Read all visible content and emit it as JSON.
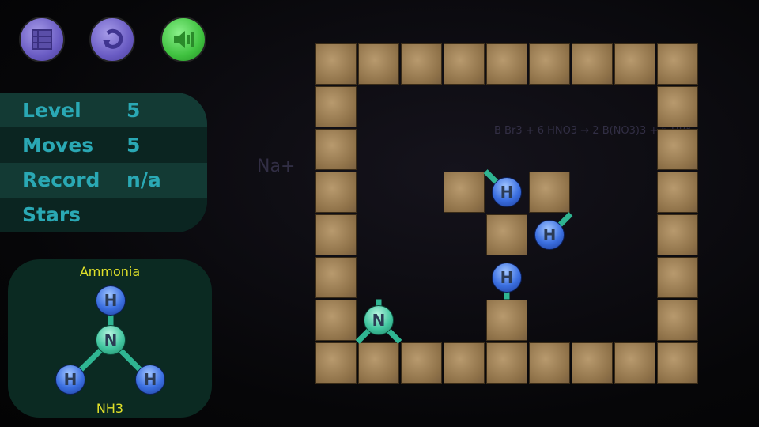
{
  "toolbar": {
    "buttons": [
      {
        "name": "menu",
        "icon": "level-menu-icon",
        "color": "#6a5cc4"
      },
      {
        "name": "restart",
        "icon": "restart-icon",
        "color": "#6a5cc4"
      },
      {
        "name": "sound",
        "icon": "speaker-icon",
        "color": "#3fc13f"
      }
    ]
  },
  "stats": {
    "level_label": "Level",
    "level_value": "5",
    "moves_label": "Moves",
    "moves_value": "5",
    "record_label": "Record",
    "record_value": "n/a",
    "stars_label": "Stars"
  },
  "target_molecule": {
    "name": "Ammonia",
    "formula": "NH3",
    "atoms": [
      {
        "element": "H"
      },
      {
        "element": "N"
      },
      {
        "element": "H"
      },
      {
        "element": "H"
      }
    ]
  },
  "board": {
    "map": [
      "#########",
      "#.......#",
      "#.......#",
      "#..#.#..#",
      "#...#...#",
      "#.......#",
      "#...#...#",
      "#########"
    ],
    "atoms": [
      {
        "element": "H",
        "row": 3,
        "col": 4,
        "bonds": [
          "up-left"
        ]
      },
      {
        "element": "H",
        "row": 4,
        "col": 5,
        "bonds": [
          "up-right"
        ]
      },
      {
        "element": "H",
        "row": 5,
        "col": 4,
        "bonds": [
          "down"
        ]
      },
      {
        "element": "N",
        "row": 6,
        "col": 1,
        "bonds": [
          "up",
          "down-left",
          "down-right"
        ]
      }
    ]
  },
  "background": {
    "formula_text": "B Br3 + 6 HNO3 → 2 B(NO3)3 + 6 HBr",
    "ion": "Na+"
  }
}
